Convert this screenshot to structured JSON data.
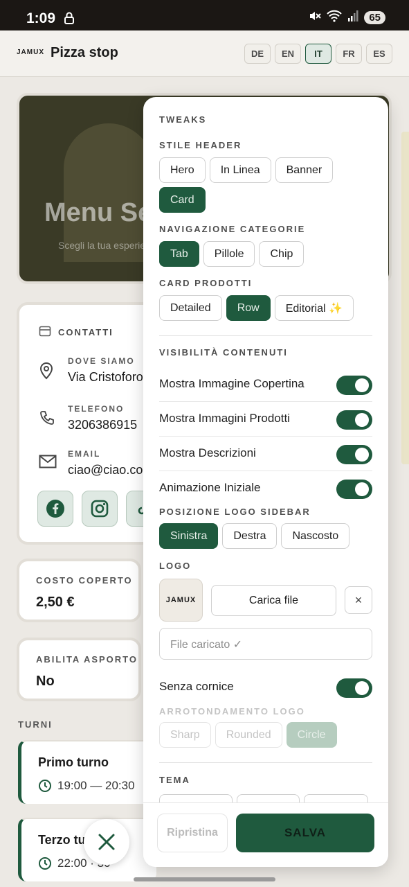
{
  "status": {
    "time": "1:09",
    "battery": "65"
  },
  "header": {
    "logo_text": "JAMUX",
    "title": "Pizza stop",
    "languages": [
      "DE",
      "EN",
      "IT",
      "FR",
      "ES"
    ],
    "active_language": "IT"
  },
  "cover": {
    "title": "Menu Se",
    "subtitle": "Scegli la tua esperienza"
  },
  "contacts": {
    "heading": "CONTATTI",
    "where_label": "DOVE SIAMO",
    "where_value": "Via Cristoforo",
    "phone_label": "TELEFONO",
    "phone_value": "3206386915",
    "email_label": "EMAIL",
    "email_value": "ciao@ciao.co"
  },
  "cover_charge": {
    "label": "COSTO COPERTO",
    "value": "2,50 €"
  },
  "takeaway": {
    "label": "ABILITA ASPORTO",
    "value": "No"
  },
  "turni": {
    "label": "TURNI",
    "items": [
      {
        "name": "Primo turno",
        "time": "19:00 — 20:30"
      },
      {
        "name": "Terzo tu",
        "time": "22:00 · 30"
      }
    ]
  },
  "tweaks": {
    "title": "TWEAKS",
    "header_style": {
      "label": "STILE HEADER",
      "options": [
        "Hero",
        "In Linea",
        "Banner",
        "Card"
      ],
      "selected": "Card"
    },
    "category_nav": {
      "label": "NAVIGAZIONE CATEGORIE",
      "options": [
        "Tab",
        "Pillole",
        "Chip"
      ],
      "selected": "Tab"
    },
    "product_card": {
      "label": "CARD PRODOTTI",
      "options": [
        "Detailed",
        "Row",
        "Editorial ✨"
      ],
      "selected": "Row"
    },
    "visibility": {
      "label": "VISIBILITÀ CONTENUTI",
      "toggles": [
        {
          "label": "Mostra Immagine Copertina",
          "on": true
        },
        {
          "label": "Mostra Immagini Prodotti",
          "on": true
        },
        {
          "label": "Mostra Descrizioni",
          "on": true
        },
        {
          "label": "Animazione Iniziale",
          "on": true
        }
      ]
    },
    "logo_position": {
      "label": "POSIZIONE LOGO SIDEBAR",
      "options": [
        "Sinistra",
        "Destra",
        "Nascosto"
      ],
      "selected": "Sinistra"
    },
    "logo": {
      "label": "LOGO",
      "upload_label": "Carica file",
      "clear_label": "×",
      "file_placeholder": "File caricato ✓"
    },
    "frameless": {
      "label": "Senza cornice",
      "on": true
    },
    "logo_rounding": {
      "label": "ARROTONDAMENTO LOGO",
      "options": [
        "Sharp",
        "Rounded",
        "Circle"
      ],
      "selected": "Circle"
    },
    "theme": {
      "label": "TEMA"
    },
    "reset_label": "Ripristina",
    "save_label": "SALVA"
  }
}
